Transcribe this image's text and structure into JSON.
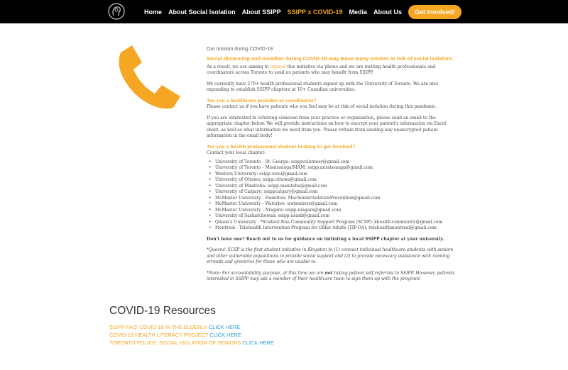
{
  "nav": {
    "items": [
      {
        "label": "Home",
        "active": false
      },
      {
        "label": "About Social Isolation",
        "active": false
      },
      {
        "label": "About SSIPP",
        "active": false
      },
      {
        "label": "SSIPP x COVID-19",
        "active": true
      },
      {
        "label": "Media",
        "active": false
      },
      {
        "label": "About Us",
        "active": false
      }
    ],
    "cta_label": "Get Involved!"
  },
  "mission": {
    "heading": "Our mission during COVID-19",
    "lead": "Social distancing and isolation during COVID-19 may leave many seniors at risk of social isolation.",
    "p1_before": "As a result, we are aiming to ",
    "p1_link": "expand",
    "p1_after": " this initiative via phone and we are inviting health professionals and coordinators across Toronto to send us patients who may benefit from SSIPP.",
    "p2": "We currently have 270+ health professional students signed up with the University of Toronto. We are also expanding to establish SSIPP chapters at 10+ Canadian universities.",
    "provider_head": "Are you a healthcare provider or coordinator?",
    "provider_text": "Please contact us if you have patients who you feel may be at risk of social isolation during this pandemic.",
    "referral_text": "If you are interested in referring someone from your practice or organization, please send an email to the appropriate chapter below. We will provide instructions on how to encrypt your patient's information via Excel sheet, as well as what information we need from you. Please refrain from sending any unencrypted patient information in the email body!",
    "student_head": "Are you a health professional student looking to get involved?",
    "student_text": "Contact your local chapter:",
    "chapters": [
      "University of Toronto - St. George: ssippvolunteer@gmail.com",
      "University of Toronto - Mississauga/MAM: ssipp.mississauga@gmail.com",
      "Western University: ssipp.uwo@gmail.com",
      "University of Ottawa: ssipp.ottawa@gmail.com",
      "University of Manitoba: ssipp.manitoba@gmail.com",
      "University of Calgary: ssippcalgary@gmail.com",
      "McMaster University - Hamilton: MacSeniorIsolationPrevention@gmail.com",
      "McMaster University - Waterloo: watseniors@gmail.com",
      "McMaster University - Niagara: ssipp.niagara@gmail.com",
      "University of Saskatchewan: ssipp.usask@gmail.com",
      "Queen's University - *Student-Run Community Support Program (SCSP): khealth.community@gmail.com",
      "Montreal - Telehealth Intervention Program for Older Adults (TIP-OA): telehealthmontreal@gmail.com"
    ],
    "no_chapter": "Don't have one? Reach out to us for guidance on initiating a local SSIPP chapter at your university.",
    "queens_note": "*Queens' SCSP is the first student initiative in Kingston to (1) connect individual healthcare students with seniors and other vulnerable populations to provide social support and (2) to provide necessary assistance with running errands and groceries for those who are unable to.",
    "note_before": "*Note: For accountability purpose, at this time we are ",
    "note_bold": "not",
    "note_after": " taking patient self-referrals to SSIPP. However, patients interested in SSIPP may ask a member of their healthcare team to sign them up with the program!"
  },
  "resources": {
    "title": "COVID-19 Resources",
    "items": [
      {
        "label": "SSIPP FAQ: COVID-19 IN THE ELDERLY",
        "link": "CLICK HERE"
      },
      {
        "label": "COVID-19 HEALTH LITERACY PROJECT",
        "link": "CLICK HERE"
      },
      {
        "label": "TORONTO POLICE: SOCIAL ISOLATION OF SENIORS",
        "link": "CLICK HERE"
      }
    ]
  },
  "colors": {
    "accent": "#f5a623",
    "link": "#2a9fd6",
    "nav_bg": "#000000"
  },
  "icons": {
    "logo": "head-outline-logo",
    "phone": "phone-handset-icon"
  }
}
